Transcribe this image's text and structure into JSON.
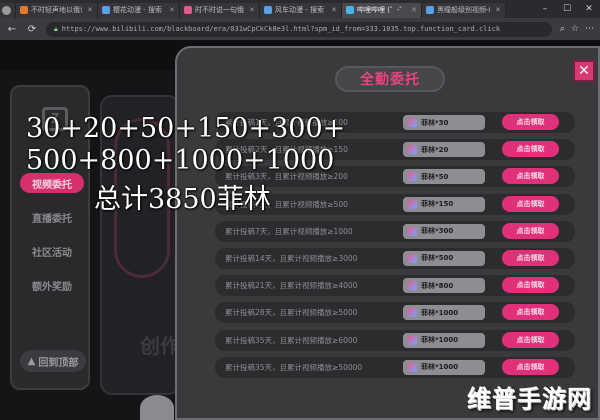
{
  "browser": {
    "tabs": [
      {
        "label": "不时轻声地以俄语...",
        "color": "#e07a2f",
        "active": false
      },
      {
        "label": "樱花动漫 - 搜索",
        "color": "#5aa0e6",
        "active": false
      },
      {
        "label": "时不时说一句俄语...",
        "color": "#e05a8a",
        "active": false
      },
      {
        "label": "风车动漫 - 搜索",
        "color": "#5aa0e6",
        "active": false
      },
      {
        "label": "哔哩哔哩 (゜-゜)つロ",
        "color": "#4ab3e8",
        "active": true
      },
      {
        "label": "黑瞳般级别视频-结果...",
        "color": "#5aa0e6",
        "active": false
      }
    ],
    "url": "https://www.bilibili.com/blackboard/era/031wCpCkCk8e3l.html?spm_id_from=333.1035.top.function_card.click"
  },
  "sidebar": {
    "logo": "Z",
    "items": [
      {
        "label": "视频委托",
        "active": true
      },
      {
        "label": "直播委托",
        "active": false
      },
      {
        "label": "社区活动",
        "active": false
      },
      {
        "label": "额外奖励",
        "active": false
      }
    ],
    "back_label": "回到顶部"
  },
  "background": {
    "create_text": "创作"
  },
  "modal": {
    "title": "全勤委托",
    "close_label": "✕",
    "rows": [
      {
        "condition": "累计投稿1天，且累计视频播放≥100",
        "reward": "菲林*30",
        "button": "点击领取"
      },
      {
        "condition": "累计投稿2天，且累计视频播放≥150",
        "reward": "菲林*20",
        "button": "点击领取"
      },
      {
        "condition": "累计投稿3天，且累计视频播放≥200",
        "reward": "菲林*50",
        "button": "点击领取"
      },
      {
        "condition": "累计投稿5天，且累计视频播放≥500",
        "reward": "菲林*150",
        "button": "点击领取"
      },
      {
        "condition": "累计投稿7天，且累计视频播放≥1000",
        "reward": "菲林*300",
        "button": "点击领取"
      },
      {
        "condition": "累计投稿14天，且累计视频播放≥3000",
        "reward": "菲林*500",
        "button": "点击领取"
      },
      {
        "condition": "累计投稿21天，且累计视频播放≥4000",
        "reward": "菲林*800",
        "button": "点击领取"
      },
      {
        "condition": "累计投稿28天，且累计视频播放≥5000",
        "reward": "菲林*1000",
        "button": "点击领取"
      },
      {
        "condition": "累计投稿35天，且累计视频播放≥6000",
        "reward": "菲林*1000",
        "button": "点击领取"
      },
      {
        "condition": "累计投稿35天，且累计视频播放≥50000",
        "reward": "菲林*1000",
        "button": "点击领取"
      }
    ]
  },
  "annotation": {
    "line1": "30+20+50+150+300+",
    "line2": "500+800+1000+1000",
    "line3": "总计3850菲林"
  },
  "watermark": "维普手游网"
}
